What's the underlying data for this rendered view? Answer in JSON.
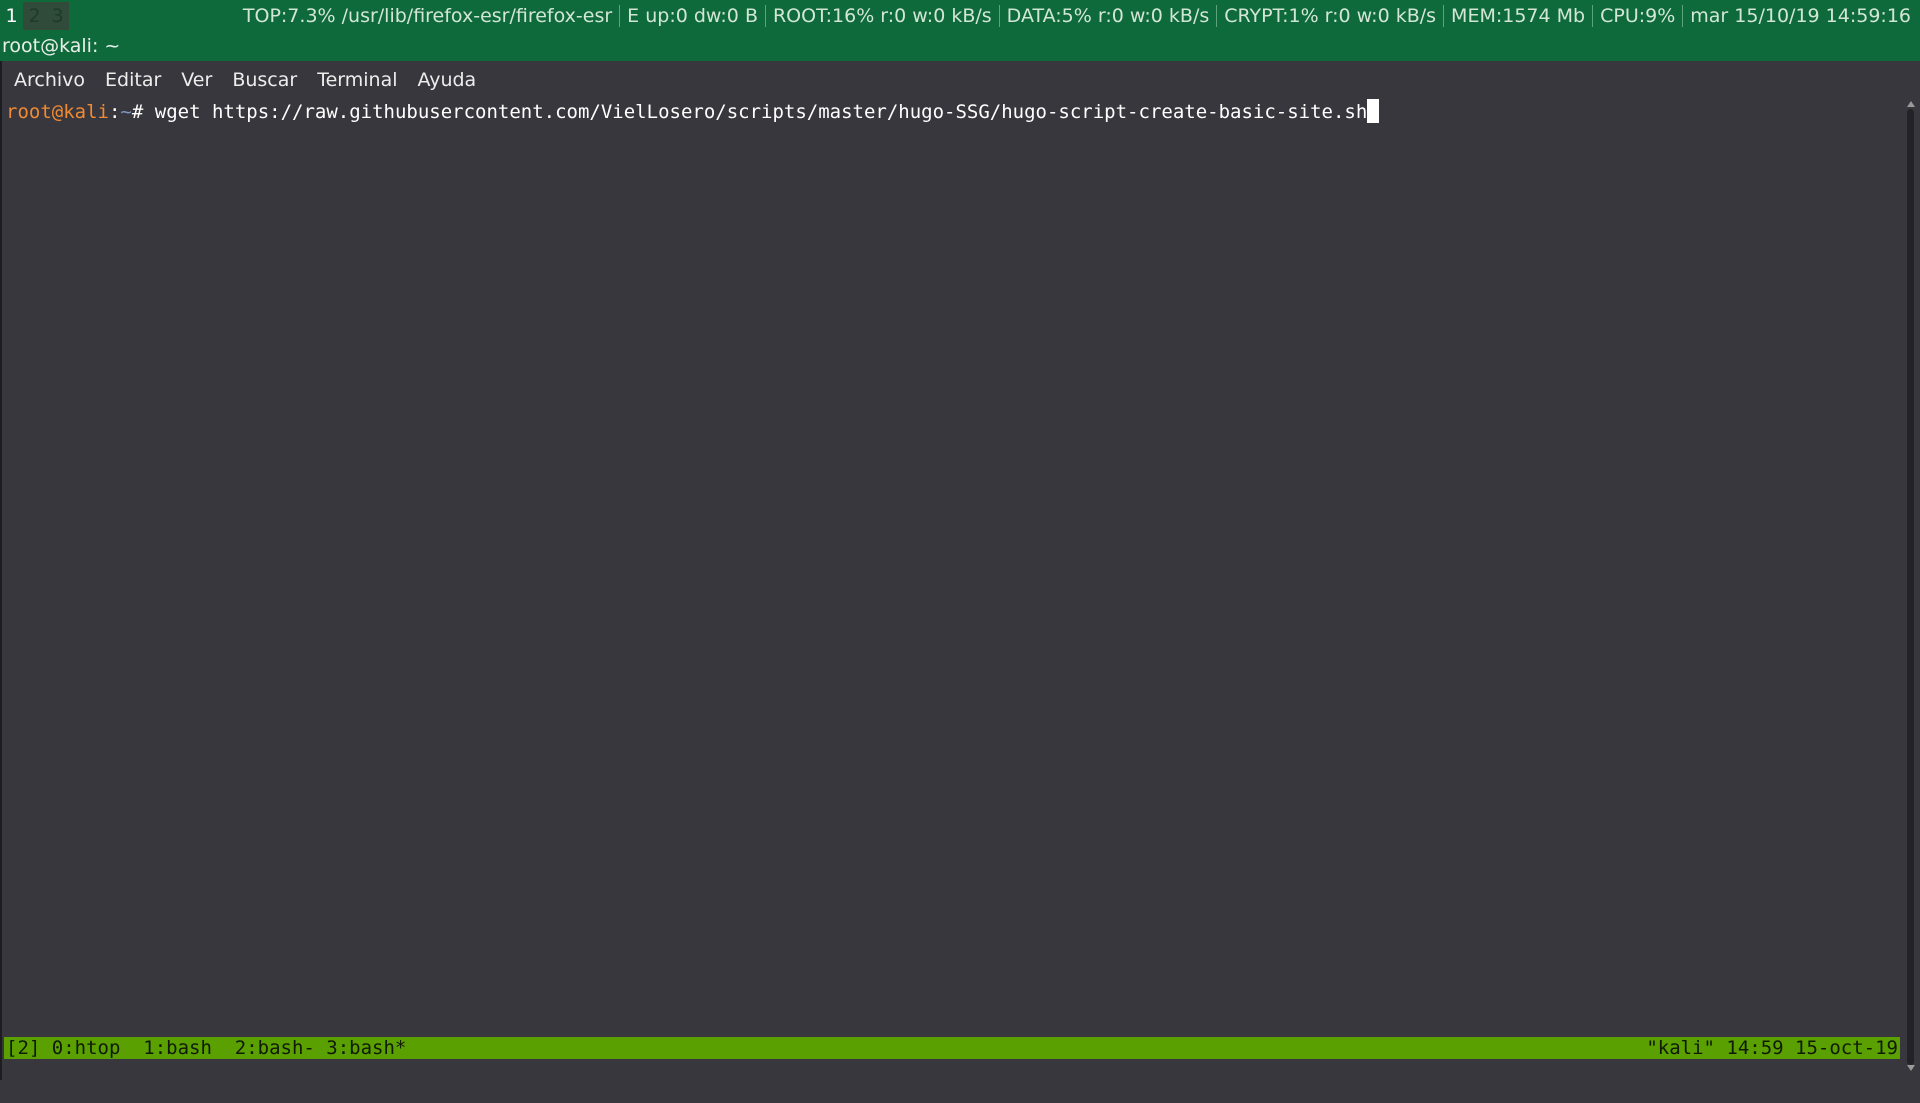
{
  "topbar": {
    "workspaces": [
      "1",
      "2",
      "3"
    ],
    "status": [
      "TOP:7.3% /usr/lib/firefox-esr/firefox-esr",
      "E up:0 dw:0 B",
      "ROOT:16% r:0 w:0 kB/s",
      "DATA:5% r:0 w:0 kB/s",
      "CRYPT:1% r:0 w:0 kB/s",
      "MEM:1574 Mb",
      "CPU:9%",
      "mar 15/10/19 14:59:16"
    ]
  },
  "window": {
    "title": "root@kali: ~"
  },
  "menubar": {
    "items": [
      "Archivo",
      "Editar",
      "Ver",
      "Buscar",
      "Terminal",
      "Ayuda"
    ]
  },
  "terminal": {
    "prompt_user": "root@kali",
    "prompt_sep": ":",
    "prompt_path": "~",
    "prompt_symbol": "# ",
    "command": "wget https://raw.githubusercontent.com/VielLosero/scripts/master/hugo-SSG/hugo-script-create-basic-site.sh"
  },
  "tmux": {
    "left": "[2] 0:htop  1:bash  2:bash- 3:bash*",
    "right": "\"kali\" 14:59 15-oct-19"
  },
  "colors": {
    "bar_green": "#0f6a3b",
    "terminal_bg": "#38373d",
    "tmux_green": "#59a000",
    "prompt_user": "#f08a33",
    "prompt_path": "#7e97c4"
  }
}
